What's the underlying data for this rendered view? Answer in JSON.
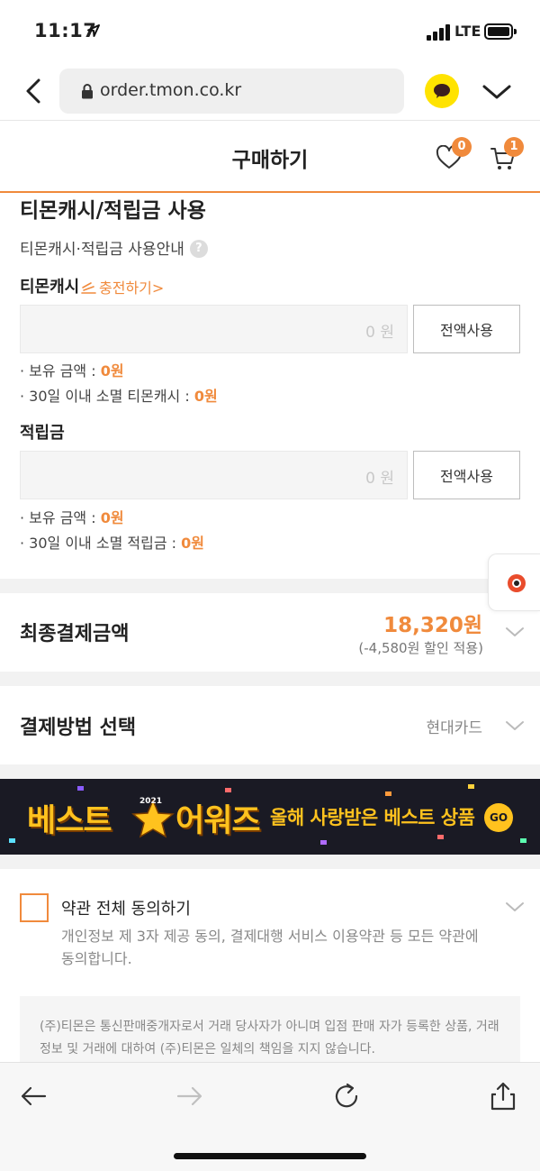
{
  "status_bar": {
    "time": "11:17",
    "network": "LTE",
    "icons": [
      "location-arrow-icon",
      "signal-icon",
      "battery-icon"
    ]
  },
  "browser": {
    "url": "order.tmon.co.kr",
    "icons": [
      "back-chevron-icon",
      "lock-icon",
      "kakao-talk-icon",
      "chevron-down-icon"
    ]
  },
  "header": {
    "title": "구매하기",
    "wish_count": "0",
    "cart_count": "1"
  },
  "cash_section": {
    "title": "티몬캐시/적립금 사용",
    "guide_text": "티몬캐시·적립금 사용안내",
    "help_glyph": "?",
    "tmon_cash": {
      "label": "티몬캐시",
      "charge_link": "충전하기>",
      "amount": "0",
      "unit": "원",
      "use_all_label": "전액사용",
      "balance_label": "· 보유 금액 : ",
      "balance_value": "0원",
      "expire_label": "· 30일 이내 소멸 티몬캐시 : ",
      "expire_value": "0원"
    },
    "points": {
      "label": "적립금",
      "amount": "0",
      "unit": "원",
      "use_all_label": "전액사용",
      "balance_label": "· 보유 금액 : ",
      "balance_value": "0원",
      "expire_label": "· 30일 이내 소멸 적립금 : ",
      "expire_value": "0원"
    }
  },
  "final_payment": {
    "label": "최종결제금액",
    "amount": "18,320원",
    "discount_note": "(-4,580원 할인 적용)"
  },
  "payment_method": {
    "label": "결제방법 선택",
    "value": "현대카드"
  },
  "banner": {
    "title_part1": "베스트",
    "year": "2021",
    "title_part2": "어워즈",
    "subtitle": "올해 사랑받은 베스트 상품",
    "go_label": "GO"
  },
  "terms": {
    "title": "약관 전체 동의하기",
    "description": "개인정보 제 3자 제공 동의, 결제대행 서비스 이용약관 등 모든 약관에 동의합니다.",
    "notice": "(주)티몬은 통신판매중개자로서 거래 당사자가 아니며 입점 판매 자가 등록한 상품, 거래 정보 및 거래에 대하여 (주)티몬은 일체의 책임을 지지 않습니다."
  },
  "colors": {
    "accent": "#f08a3c",
    "kakao": "#ffe300",
    "banner_bg": "#1a1a24",
    "banner_text": "#ffc21e"
  }
}
